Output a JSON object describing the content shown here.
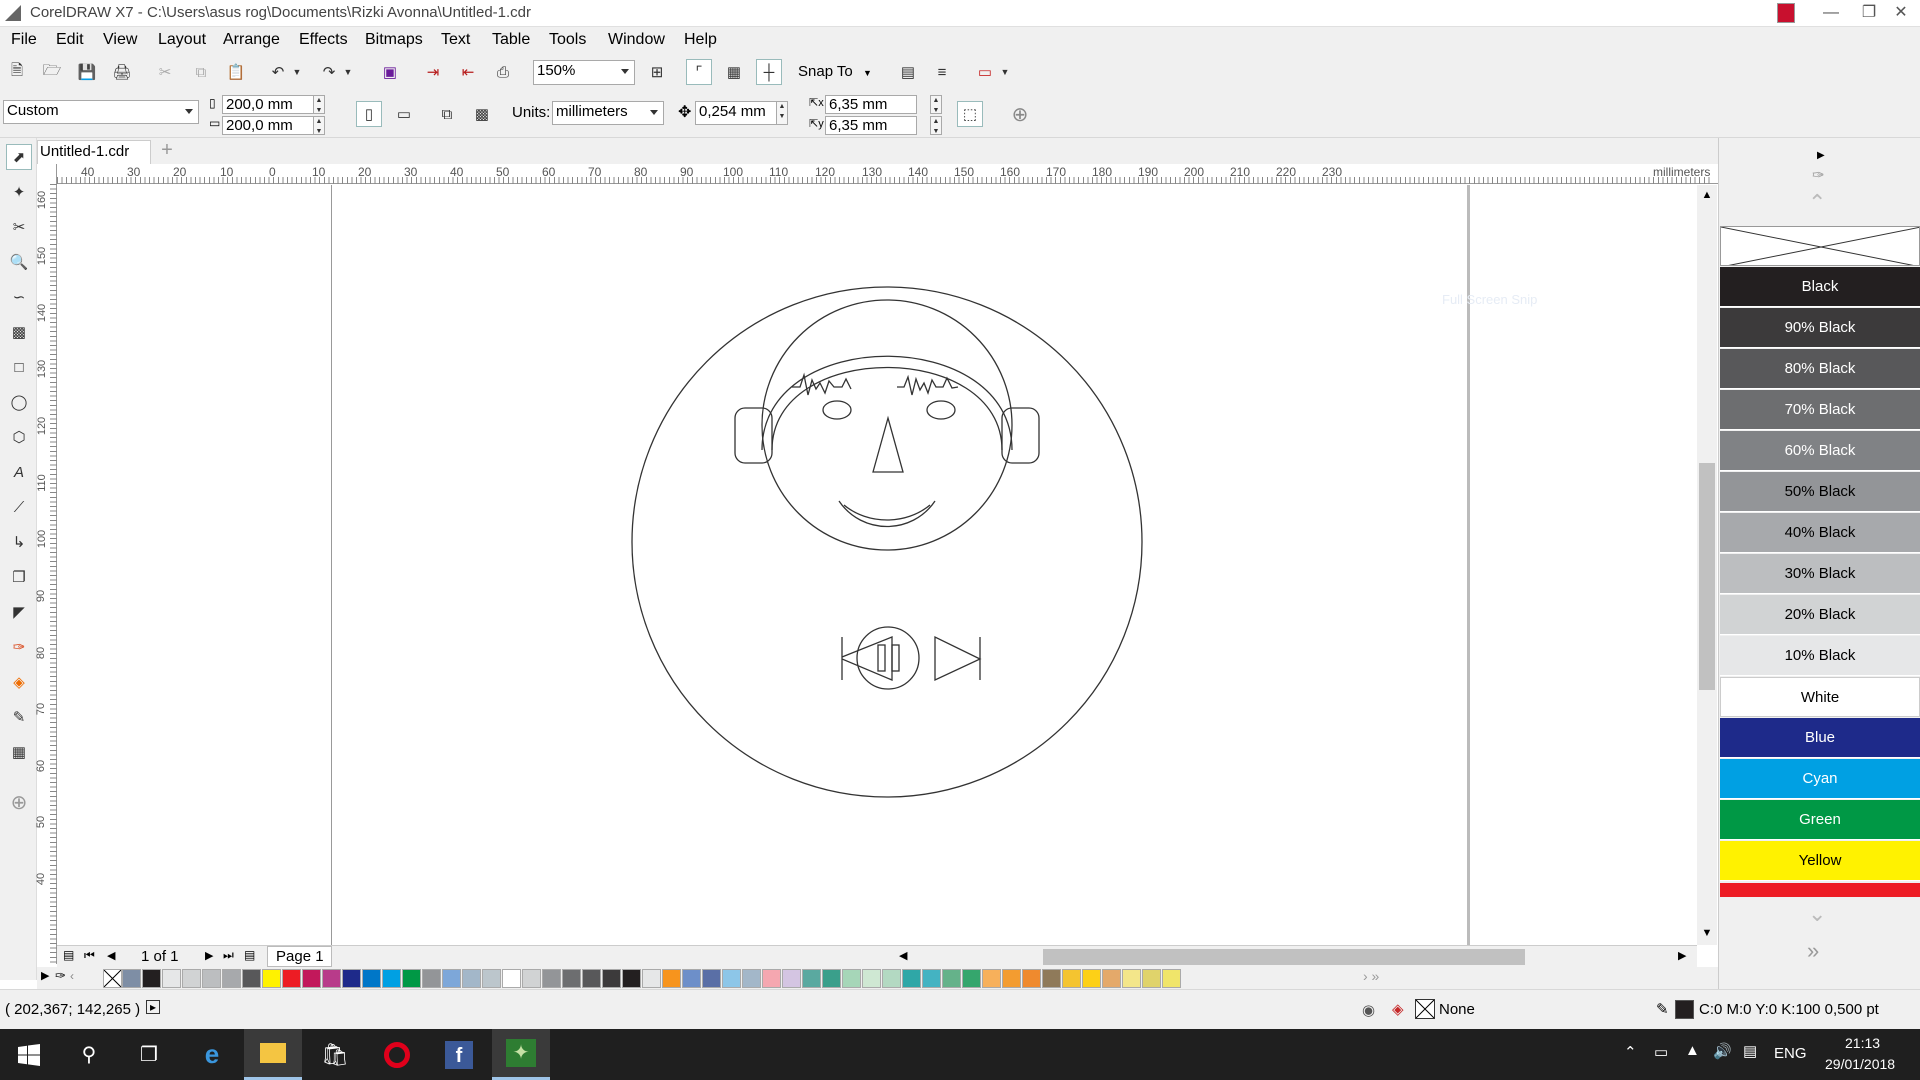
{
  "window": {
    "title": "CorelDRAW X7 - C:\\Users\\asus rog\\Documents\\Rizki Avonna\\Untitled-1.cdr"
  },
  "menu": [
    "File",
    "Edit",
    "View",
    "Layout",
    "Arrange",
    "Effects",
    "Bitmaps",
    "Text",
    "Table",
    "Tools",
    "Window",
    "Help"
  ],
  "toolbar": {
    "zoom": "150%",
    "snap_to": "Snap To"
  },
  "property_bar": {
    "page_preset": "Custom",
    "width": "200,0 mm",
    "height": "200,0 mm",
    "units_label": "Units:",
    "units": "millimeters",
    "nudge": "0,254 mm",
    "dup_x": "6,35 mm",
    "dup_y": "6,35 mm"
  },
  "document": {
    "tab": "Untitled-1.cdr",
    "page_count": "1 of 1",
    "page_tab": "Page 1",
    "ruler_unit": "millimeters"
  },
  "ruler_top_ticks": [
    "40",
    "30",
    "20",
    "10",
    "0",
    "10",
    "20",
    "30",
    "40",
    "50",
    "60",
    "70",
    "80",
    "90",
    "100",
    "110",
    "120",
    "130",
    "140",
    "150",
    "160",
    "170",
    "180",
    "190",
    "200",
    "210",
    "220",
    "230"
  ],
  "ruler_left_ticks": [
    "160",
    "150",
    "140",
    "130",
    "120",
    "110",
    "100",
    "90",
    "80",
    "70",
    "60",
    "50",
    "40"
  ],
  "canvas": {
    "ghost_text": "Full Screen Snip"
  },
  "color_palette": [
    {
      "name": "Black",
      "color": "#231f20",
      "text": "#ffffff"
    },
    {
      "name": "90% Black",
      "color": "#3c3a3b",
      "text": "#ffffff"
    },
    {
      "name": "80% Black",
      "color": "#58585a",
      "text": "#ffffff"
    },
    {
      "name": "70% Black",
      "color": "#6d6e70",
      "text": "#ffffff"
    },
    {
      "name": "60% Black",
      "color": "#808285",
      "text": "#ffffff"
    },
    {
      "name": "50% Black",
      "color": "#939598",
      "text": "#000000"
    },
    {
      "name": "40% Black",
      "color": "#a7a9ac",
      "text": "#000000"
    },
    {
      "name": "30% Black",
      "color": "#bcbec0",
      "text": "#000000"
    },
    {
      "name": "20% Black",
      "color": "#d1d3d4",
      "text": "#000000"
    },
    {
      "name": "10% Black",
      "color": "#e6e7e8",
      "text": "#000000"
    },
    {
      "name": "White",
      "color": "#ffffff",
      "text": "#000000"
    },
    {
      "name": "Blue",
      "color": "#1e2a8a",
      "text": "#ffffff"
    },
    {
      "name": "Cyan",
      "color": "#00a0e3",
      "text": "#ffffff"
    },
    {
      "name": "Green",
      "color": "#009845",
      "text": "#ffffff"
    },
    {
      "name": "Yellow",
      "color": "#fff200",
      "text": "#000000"
    }
  ],
  "bottom_swatches": [
    "#7e8ea5",
    "#231f20",
    "#e6e7e8",
    "#d1d3d4",
    "#bcbec0",
    "#a7a9ac",
    "#58585a",
    "#fff200",
    "#ed1c24",
    "#c2185b",
    "#b83b8a",
    "#1e2a8a",
    "#0077c8",
    "#00a0e3",
    "#009845",
    "#939598",
    "#7da7d9",
    "#a3b7c9",
    "#bcc6cc",
    "#ffffff",
    "#d1d3d4",
    "#939598",
    "#6d6e70",
    "#58585a",
    "#3c3a3b",
    "#231f20",
    "#e6e7e8",
    "#f7941d",
    "#6d8fc9",
    "#5a6fa6",
    "#8dc6e8",
    "#a3b7c9",
    "#f5a7b0",
    "#d4c5e2",
    "#5aa9a0",
    "#3a9f8b",
    "#a6d6b8",
    "#cfe8d3",
    "#b3d9c2",
    "#2fa7a7",
    "#44b3c2",
    "#65b28a",
    "#35a66d",
    "#f7b05b",
    "#f39c30",
    "#ef8a2e",
    "#8f7a5a",
    "#f4c430",
    "#fdd017",
    "#e4a96a",
    "#f3e68a",
    "#e0d36b",
    "#f0e56a"
  ],
  "status": {
    "coords": "( 202,367; 142,265 )",
    "fill": "None",
    "outline": "C:0 M:0 Y:0 K:100  0,500 pt"
  },
  "taskbar": {
    "lang": "ENG",
    "time": "21:13",
    "date": "29/01/2018"
  }
}
